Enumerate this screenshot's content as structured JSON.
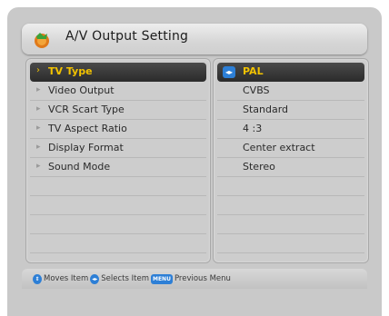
{
  "title": "A/V Output Setting",
  "menu": {
    "items": [
      {
        "label": "TV Type",
        "value": "PAL"
      },
      {
        "label": "Video Output",
        "value": "CVBS"
      },
      {
        "label": "VCR Scart Type",
        "value": "Standard"
      },
      {
        "label": "TV Aspect Ratio",
        "value": "4 :3"
      },
      {
        "label": "Display Format",
        "value": "Center extract"
      },
      {
        "label": "Sound Mode",
        "value": "Stereo"
      }
    ],
    "selected_index": 0
  },
  "help": {
    "moves": "Moves Item",
    "selects": "Selects Item",
    "menu_key": "MENU",
    "previous": "Previous Menu"
  },
  "colors": {
    "highlight_text": "#f2c200",
    "key_blue": "#2d7fd6",
    "background": "#c9c9c9"
  }
}
